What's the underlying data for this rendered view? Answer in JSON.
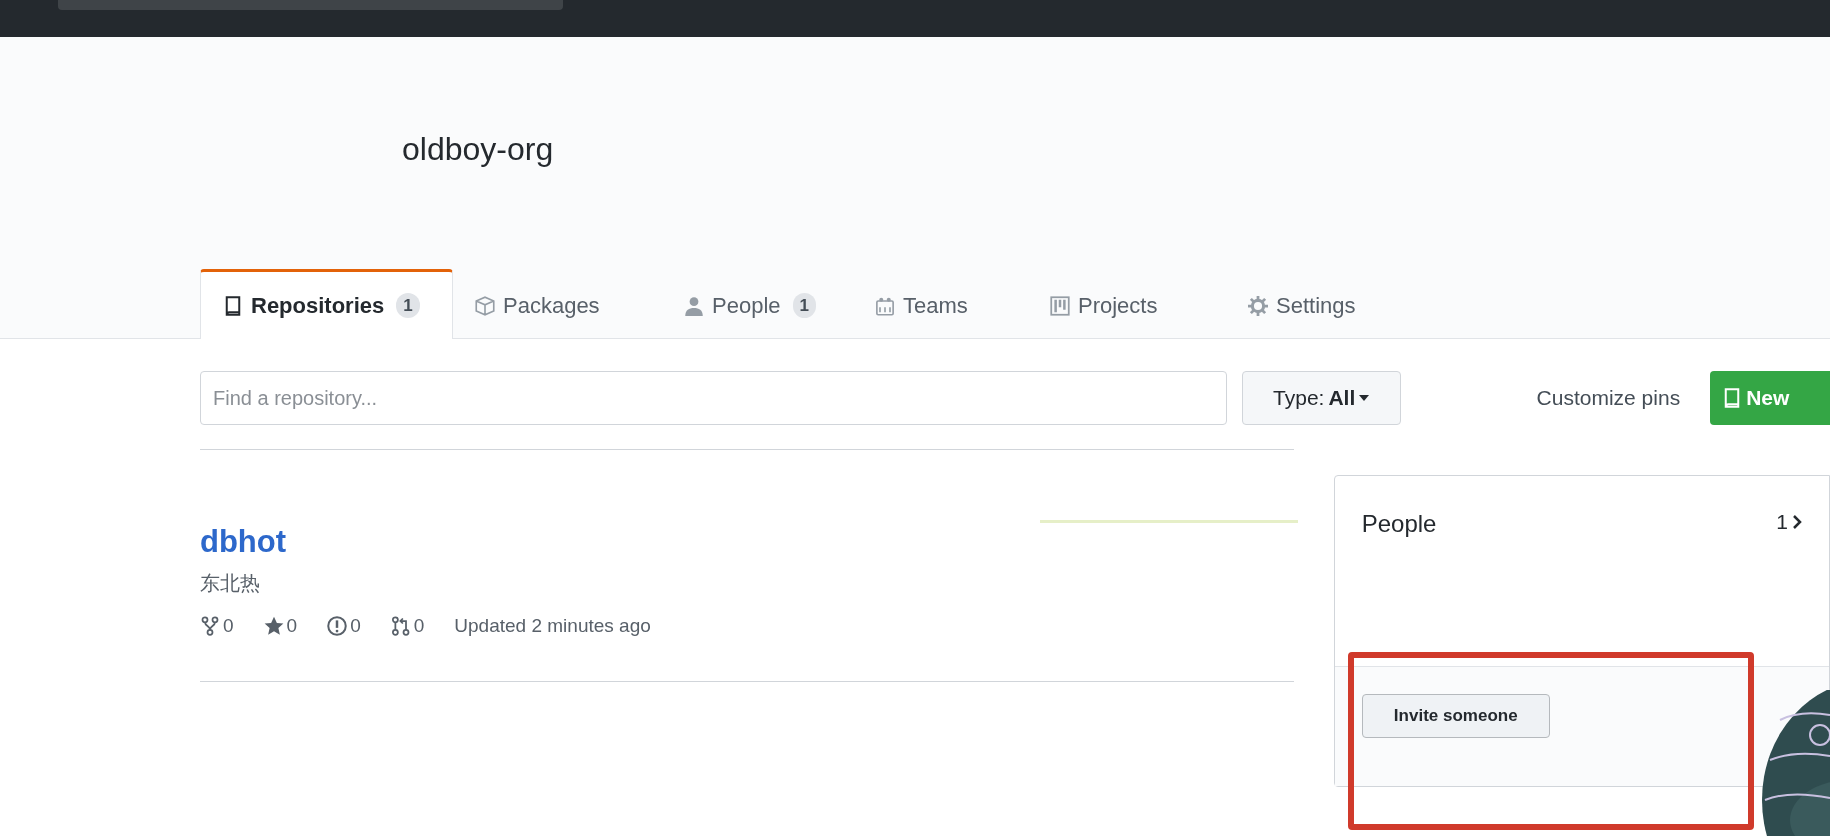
{
  "org": {
    "name": "oldboy-org"
  },
  "tabs": [
    {
      "label": "Repositories",
      "kind": "repo",
      "count": "1",
      "selected": true
    },
    {
      "label": "Packages",
      "kind": "package",
      "selected": false
    },
    {
      "label": "People",
      "kind": "person",
      "count": "1",
      "selected": false
    },
    {
      "label": "Teams",
      "kind": "team",
      "selected": false
    },
    {
      "label": "Projects",
      "kind": "project",
      "selected": false
    },
    {
      "label": "Settings",
      "kind": "gear",
      "selected": false
    }
  ],
  "search": {
    "placeholder": "Find a repository..."
  },
  "type_filter": {
    "label": "Type:",
    "value": "All"
  },
  "customize_pins": "Customize pins",
  "new_button": "New",
  "repositories": [
    {
      "name": "dbhot",
      "description": "东北热",
      "stats": [
        {
          "kind": "fork",
          "value": "0"
        },
        {
          "kind": "star",
          "value": "0"
        },
        {
          "kind": "issue",
          "value": "0"
        },
        {
          "kind": "pull",
          "value": "0"
        }
      ],
      "updated": "Updated 2 minutes ago"
    }
  ],
  "people_card": {
    "title": "People",
    "count": "1",
    "invite_button": "Invite someone"
  }
}
